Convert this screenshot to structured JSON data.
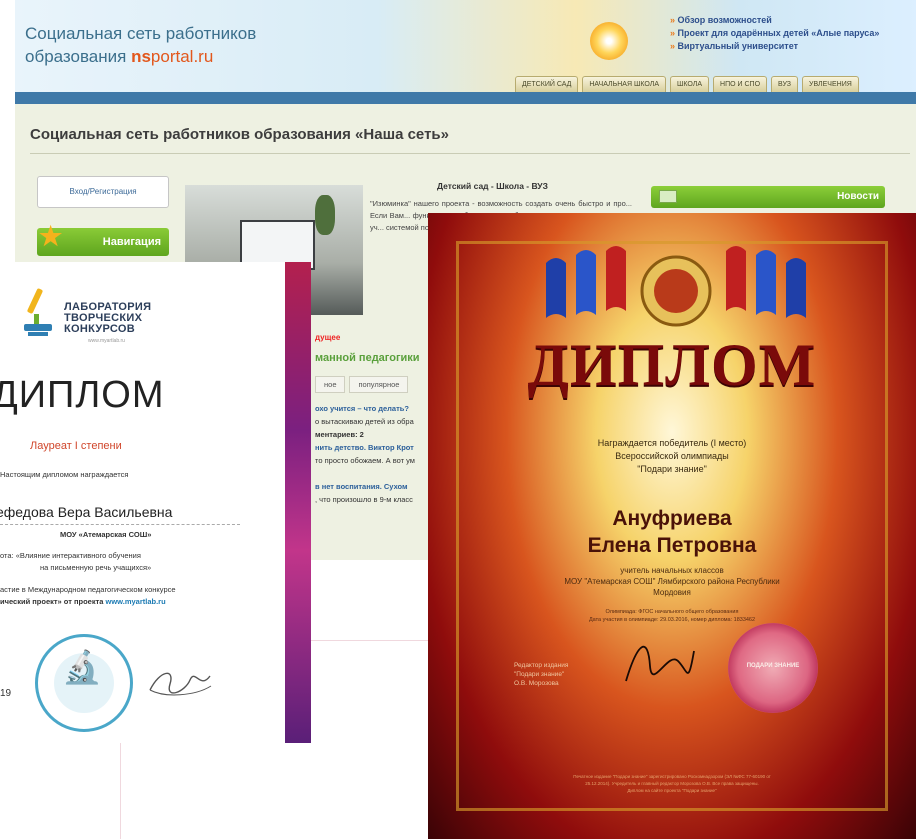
{
  "site": {
    "logo_line1": "Социальная сеть работников",
    "logo_line2_prefix": "образования ",
    "logo_ns": "ns",
    "logo_portal": "portal.ru",
    "promo": [
      "Обзор возможностей",
      "Проект для одарённых детей «Алые паруса»",
      "Виртуальный университет"
    ],
    "tabs": [
      "ДЕТСКИЙ САД",
      "НАЧАЛЬНАЯ ШКОЛА",
      "ШКОЛА",
      "НПО И СПО",
      "ВУЗ",
      "УВЛЕЧЕНИЯ"
    ],
    "title": "Социальная сеть работников образования «Наша сеть»",
    "login_button": "Вход/Регистрация",
    "nav_label": "Навигация",
    "article_heading": "Детский сад - Школа - ВУЗ",
    "article_text": "\"Изюминка\" нашего проекта - возможность создать очень быстро и про... Если Вам... функционал... большие о... образовате... В сети со... 1'094'124 уч... системой по...",
    "news_label": "Новости",
    "sub_label": "дущее",
    "sub_heading": "манной педагогики",
    "sub_tabs": [
      "ное",
      "популярное"
    ],
    "lines": [
      {
        "text": "охо учится – что делать?",
        "accent": true
      },
      {
        "text": "о вытаскиваю детей из обра",
        "accent": false
      },
      {
        "text": "ментариев: 2",
        "accent": false
      },
      {
        "text": "нить детство. Виктор Крот",
        "accent": true
      },
      {
        "text": "то просто обожаем. А вот ум",
        "accent": false
      },
      {
        "text": "",
        "accent": false
      },
      {
        "text": "в нет воспитания. Сухом",
        "accent": true
      },
      {
        "text": ", что произошло в 9-м класс",
        "accent": false
      }
    ]
  },
  "diploma_left": {
    "lab_title_1": "ЛАБОРАТОРИЯ",
    "lab_title_2": "ТВОРЧЕСКИХ",
    "lab_title_3": "КОНКУРСОВ",
    "lab_url": "www.myartlab.ru",
    "title": "ДИПЛОМ",
    "laureate": "Лауреат I степени",
    "awarded_text": "Настоящим дипломом награждается",
    "person": "ефедова Вера Васильевна",
    "school": "МОУ «Атемарская СОШ»",
    "work_line1": "ота: «Влияние интерактивного обучения",
    "work_line2": "на письменную речь учащихся»",
    "contest_line1": "астие в Международном педагогическом конкурсе",
    "contest_line2_prefix": "ический проект» от проекта ",
    "contest_url": "www.myartlab.ru",
    "year": "19"
  },
  "diploma_right": {
    "title": "ДИПЛОМ",
    "award_line1": "Награждается победитель (I место)",
    "award_line2": "Всероссийской олимпиады",
    "award_line3": "\"Подари знание\"",
    "recipient_line1": "Ануфриева",
    "recipient_line2": "Елена Петровна",
    "teacher_line1": "учитель начальных классов",
    "teacher_line2": "МОУ \"Атемарская СОШ\" Лямбирского района Республики",
    "teacher_line3": "Мордовия",
    "small_line1": "Олимпиада: ФГОС начального общего образования",
    "small_line2": "Дата участия в олимпиаде: 29.03.2016, номер диплома: 1833462",
    "editor_line1": "Редактор издания",
    "editor_line2": "\"Подари знание\"",
    "editor_line3": "О.В. Морозова",
    "stamp_label": "ПОДАРИ ЗНАНИЕ",
    "footnote_line1": "Печатное издание \"Подари знание\" зарегистрировано Роскомнадзором (ЭЛ №ФС 77-60190 от",
    "footnote_line2": "25.12.2014). Учредитель и главный редактор Морозова О.В. Все права защищены.",
    "footnote_line3": "Диплом на сайте проекта \"Подари знание\""
  }
}
